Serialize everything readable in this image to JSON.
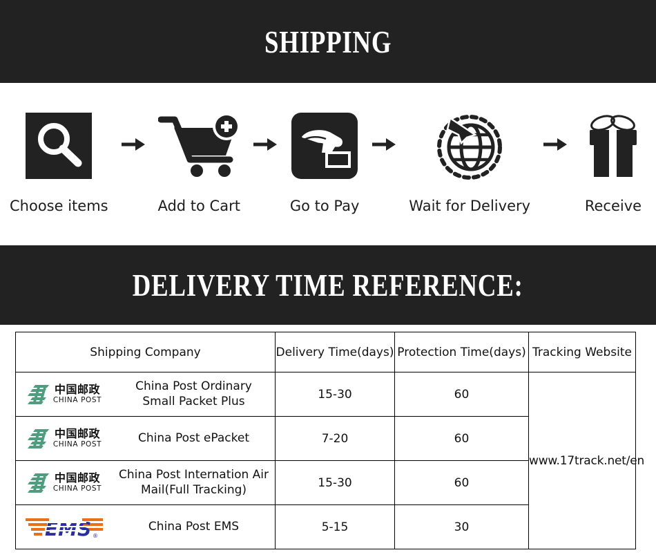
{
  "banners": {
    "shipping_title": "SHIPPING",
    "delivery_title": "DELIVERY TIME REFERENCE:",
    "bg_color": "#222222",
    "text_color": "#ffffff"
  },
  "steps": [
    {
      "label": "Choose items",
      "icon": "magnifier-search-icon"
    },
    {
      "label": "Add to Cart",
      "icon": "shopping-cart-plus-icon"
    },
    {
      "label": "Go to Pay",
      "icon": "hand-card-payment-icon"
    },
    {
      "label": "Wait for Delivery",
      "icon": "globe-airplane-icon"
    },
    {
      "label": "Receive",
      "icon": "gift-box-icon"
    }
  ],
  "arrow_icon": "arrow-right-icon",
  "table": {
    "headers": [
      "Shipping Company",
      "Delivery Time(days)",
      "Protection Time(days)",
      "Tracking Website"
    ],
    "tracking_website": "www.17track.net/en",
    "rows": [
      {
        "logo": "china-post-logo",
        "logo_cn": "中国邮政",
        "logo_en": "CHINA POST",
        "company": "China Post Ordinary Small Packet Plus",
        "delivery_time": "15-30",
        "protection_time": "60"
      },
      {
        "logo": "china-post-logo",
        "logo_cn": "中国邮政",
        "logo_en": "CHINA POST",
        "company": "China Post ePacket",
        "delivery_time": "7-20",
        "protection_time": "60"
      },
      {
        "logo": "china-post-logo",
        "logo_cn": "中国邮政",
        "logo_en": "CHINA POST",
        "company": "China Post Internation Air Mail(Full Tracking)",
        "delivery_time": "15-30",
        "protection_time": "60"
      },
      {
        "logo": "ems-logo",
        "logo_text": "EMS",
        "company": "China Post EMS",
        "delivery_time": "5-15",
        "protection_time": "30"
      }
    ]
  },
  "colors": {
    "china_post_green": "#4e9e7e",
    "ems_blue": "#2b2f9e",
    "ems_orange": "#e8701a",
    "dark": "#222222"
  }
}
